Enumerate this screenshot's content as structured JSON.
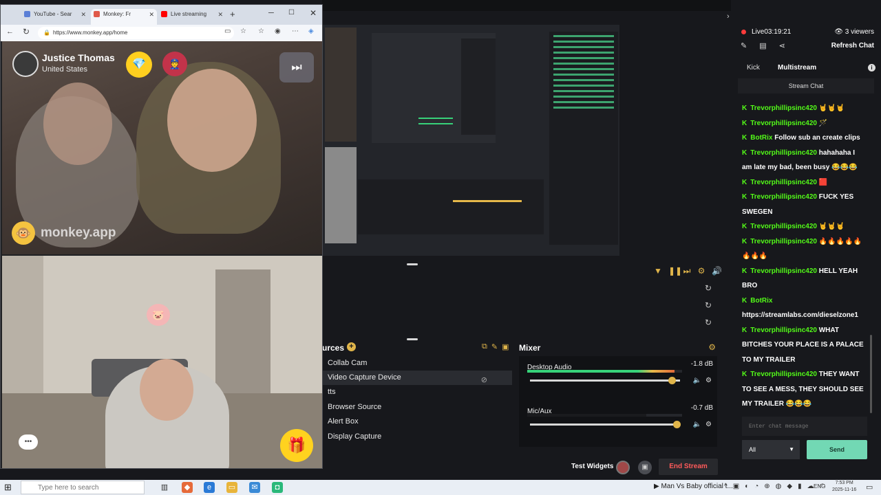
{
  "browser": {
    "tabs": [
      {
        "label": "YouTube - Sear",
        "favicon_color": "#5b7fd6"
      },
      {
        "label": "Monkey: Fr",
        "favicon_color": "#e05a4a"
      },
      {
        "label": "Live streaming",
        "favicon_color": "#ff0000"
      }
    ],
    "url": "https://www.monkey.app/home"
  },
  "monkey": {
    "user_name": "Justice Thomas",
    "user_country": "United States",
    "logo_text": "monkey.app"
  },
  "streamlabs": {
    "sources_title": "urces",
    "sources": [
      "Collab Cam",
      "Video Capture Device",
      "tts",
      "Browser Source",
      "Alert Box",
      "Display Capture"
    ],
    "selected_source": 1,
    "mixer_title": "Mixer",
    "mixer_channels": [
      {
        "name": "Desktop Audio",
        "db": "-1.8 dB",
        "level": 0.95,
        "volume": 0.95
      },
      {
        "name": "Mic/Aux",
        "db": "-0.7 dB",
        "level": 0.77,
        "volume": 0.98
      }
    ],
    "test_widgets": "Test Widgets",
    "end_stream": "End Stream"
  },
  "chat": {
    "live_time": "Live03:19:21",
    "viewers": "3 viewers",
    "refresh": "Refresh Chat",
    "tabs": [
      "Kick",
      "Multistream"
    ],
    "active_tab": 1,
    "subheader": "Stream Chat",
    "messages": [
      {
        "user": "Trevorphillipsinc420",
        "text": "🤘🤘🤘"
      },
      {
        "user": "Trevorphillipsinc420",
        "text": "🪄"
      },
      {
        "user": "BotRix",
        "text": "Follow sub an create clips"
      },
      {
        "user": "Trevorphillipsinc420",
        "text": "hahahaha I am late my bad, been busy 😂😂😂"
      },
      {
        "user": "Trevorphillipsinc420",
        "text": "🟥"
      },
      {
        "user": "Trevorphillipsinc420",
        "text": "FUCK YES SWEGEN"
      },
      {
        "user": "Trevorphillipsinc420",
        "text": "🤘🤘🤘"
      },
      {
        "user": "Trevorphillipsinc420",
        "text": "🔥🔥🔥🔥🔥🔥🔥🔥"
      },
      {
        "user": "Trevorphillipsinc420",
        "text": "HELL YEAH BRO"
      },
      {
        "user": "BotRix",
        "text": "https://streamlabs.com/dieselzone1"
      },
      {
        "user": "Trevorphillipsinc420",
        "text": "WHAT BITCHES YOUR PLACE IS A PALACE TO MY TRAILER"
      },
      {
        "user": "Trevorphillipsinc420",
        "text": "THEY WANT TO SEE A MESS, THEY SHOULD SEE MY TRAILER 😂😂😂"
      }
    ],
    "input_placeholder": "Enter chat message",
    "filter_value": "All",
    "send_label": "Send"
  },
  "taskbar": {
    "search_placeholder": "Type here to search",
    "media": "Man Vs Baby official t...",
    "lang": "ENG",
    "time": "7:53 PM",
    "date": "2025-11-16"
  }
}
